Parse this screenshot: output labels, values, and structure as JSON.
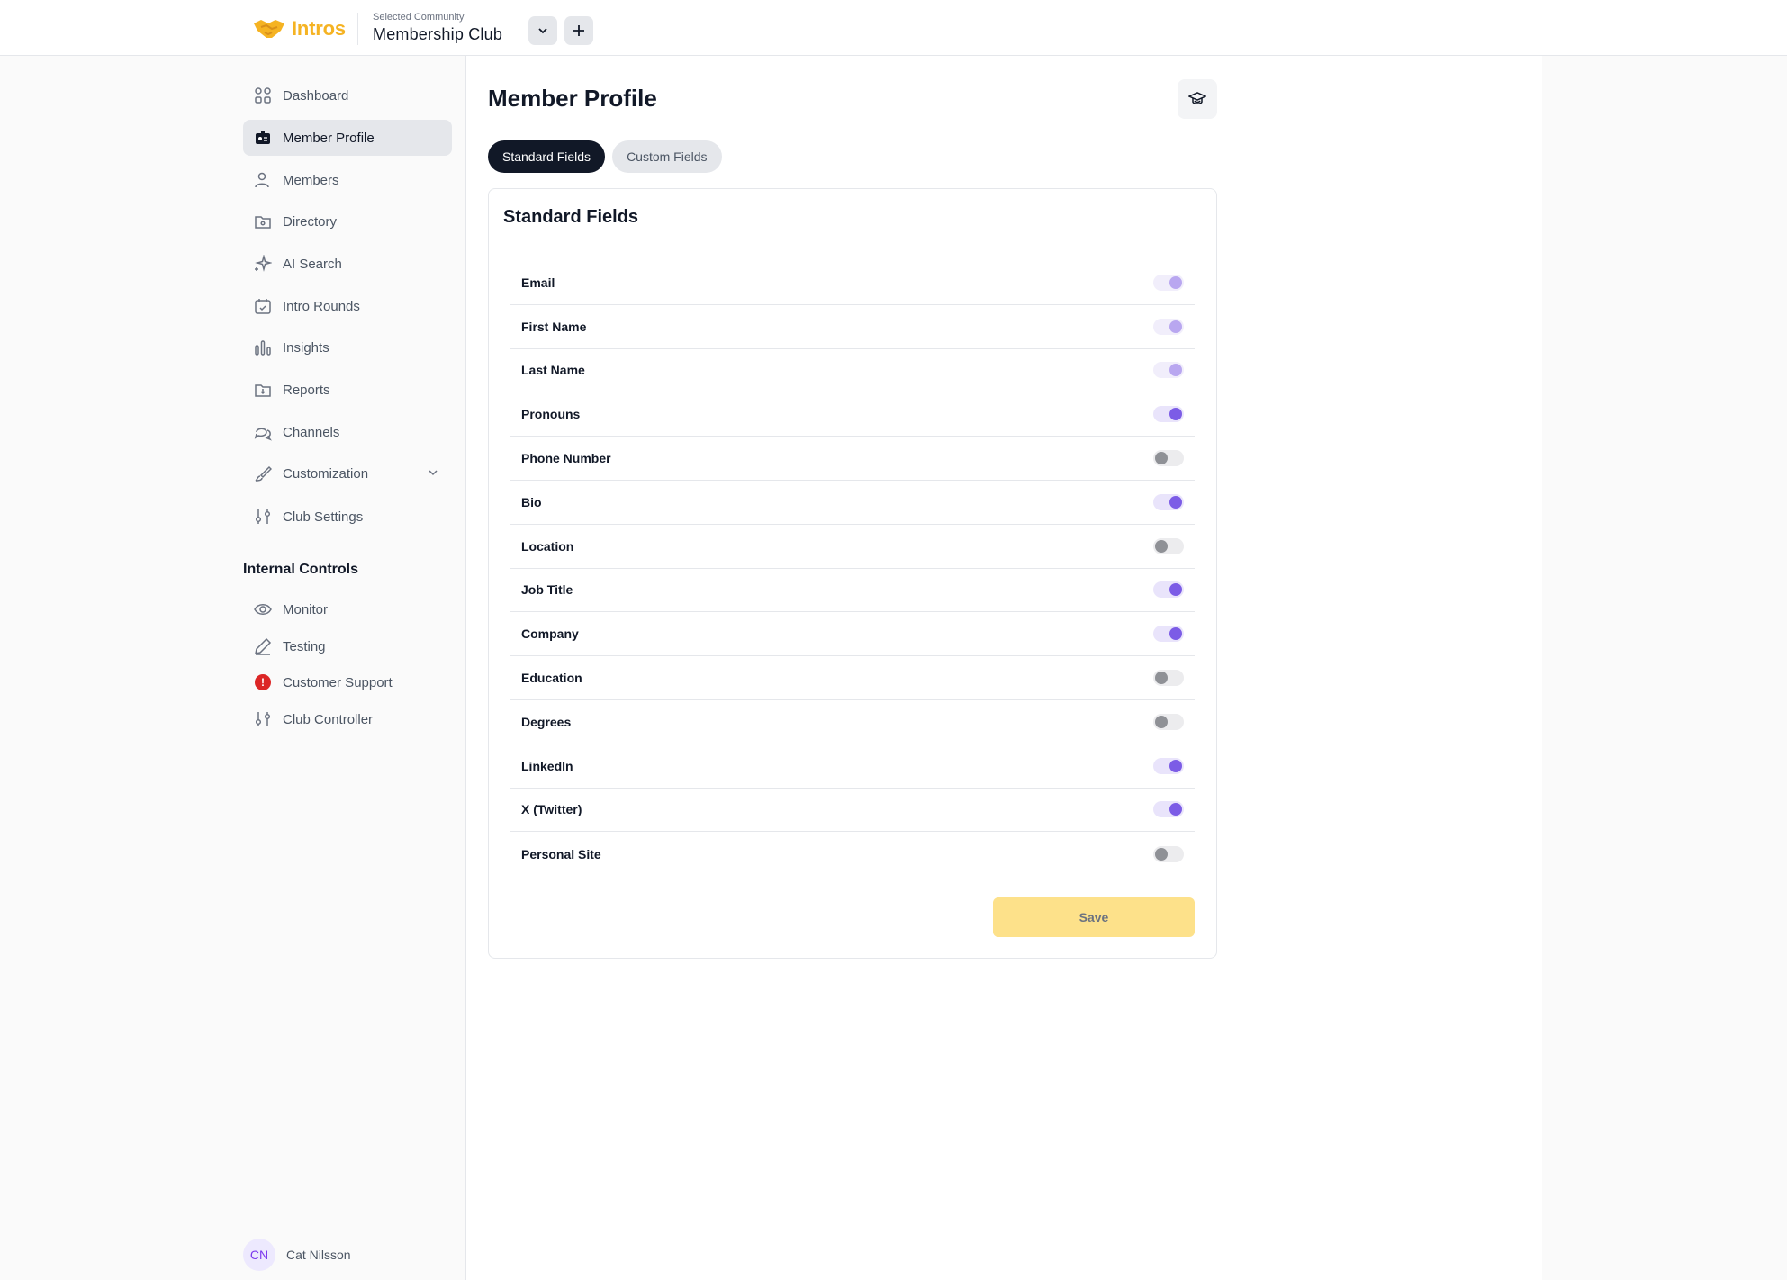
{
  "app": {
    "name": "Intros",
    "brand_color": "#f5b323"
  },
  "community": {
    "label": "Selected Community",
    "name": "Membership Club"
  },
  "topbar": {
    "dropdown_icon": "chevron-down-icon",
    "add_icon": "plus-icon"
  },
  "sidebar": {
    "items": [
      {
        "label": "Dashboard",
        "icon": "grid-icon"
      },
      {
        "label": "Member Profile",
        "icon": "id-card-icon",
        "active": true
      },
      {
        "label": "Members",
        "icon": "users-icon"
      },
      {
        "label": "Directory",
        "icon": "folder-icon"
      },
      {
        "label": "AI Search",
        "icon": "sparkle-icon"
      },
      {
        "label": "Intro Rounds",
        "icon": "calendar-icon"
      },
      {
        "label": "Insights",
        "icon": "bar-chart-icon"
      },
      {
        "label": "Reports",
        "icon": "folder-download-icon"
      },
      {
        "label": "Channels",
        "icon": "chat-icon"
      },
      {
        "label": "Customization",
        "icon": "brush-icon"
      },
      {
        "label": "Club Settings",
        "icon": "sliders-icon"
      }
    ],
    "internal_heading": "Internal Controls",
    "internal_items": [
      {
        "label": "Monitor",
        "icon": "eye-icon"
      },
      {
        "label": "Testing",
        "icon": "pencil-icon"
      },
      {
        "label": "Customer Support",
        "icon": "alert-icon"
      },
      {
        "label": "Club Controller",
        "icon": "sliders-icon"
      }
    ],
    "user": {
      "initials": "CN",
      "name": "Cat Nilsson"
    }
  },
  "main": {
    "title": "Member Profile",
    "tabs": [
      {
        "label": "Standard Fields",
        "active": true
      },
      {
        "label": "Custom Fields",
        "active": false
      }
    ],
    "card_title": "Standard Fields",
    "fields": [
      {
        "label": "Email",
        "enabled": true,
        "locked": true
      },
      {
        "label": "First Name",
        "enabled": true,
        "locked": true
      },
      {
        "label": "Last Name",
        "enabled": true,
        "locked": true
      },
      {
        "label": "Pronouns",
        "enabled": true
      },
      {
        "label": "Phone Number",
        "enabled": false
      },
      {
        "label": "Bio",
        "enabled": true
      },
      {
        "label": "Location",
        "enabled": false
      },
      {
        "label": "Job Title",
        "enabled": true
      },
      {
        "label": "Company",
        "enabled": true
      },
      {
        "label": "Education",
        "enabled": false
      },
      {
        "label": "Degrees",
        "enabled": false
      },
      {
        "label": "LinkedIn",
        "enabled": true
      },
      {
        "label": "X (Twitter)",
        "enabled": true
      },
      {
        "label": "Personal Site",
        "enabled": false
      }
    ],
    "save_label": "Save"
  },
  "colors": {
    "accent": "#7c5ce6",
    "save_bg": "#fde18a",
    "tab_active": "#111827",
    "alert": "#dc2626"
  }
}
